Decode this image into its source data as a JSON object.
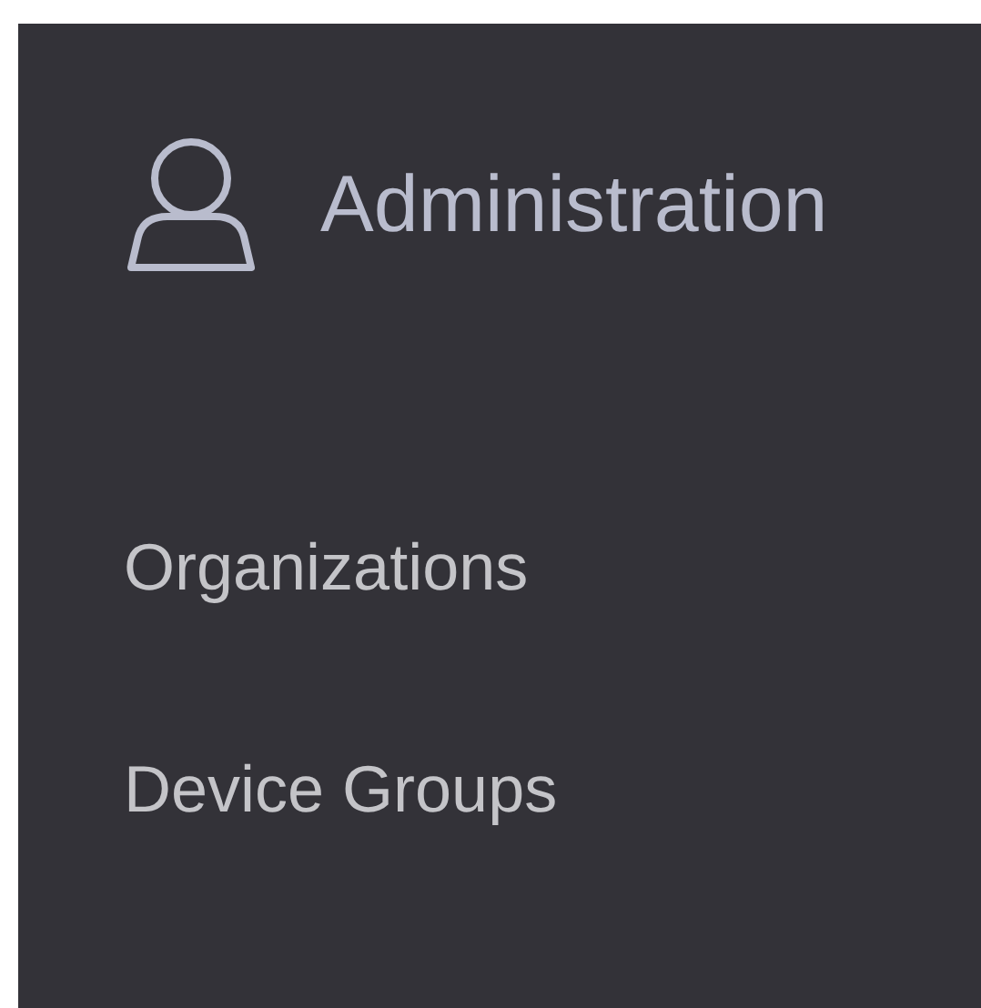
{
  "header": {
    "title": "Administration"
  },
  "menu_items": [
    "Organizations",
    "Device Groups"
  ]
}
